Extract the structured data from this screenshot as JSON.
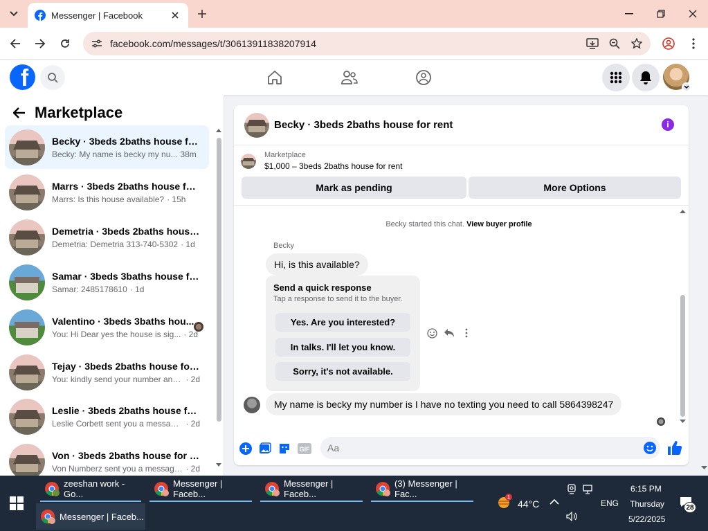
{
  "browser": {
    "tab_title": "Messenger | Facebook",
    "url": "facebook.com/messages/t/30613911838207914"
  },
  "sidebar": {
    "title": "Marketplace",
    "conversations": [
      {
        "name": "Becky · 3beds 2baths house for ...",
        "preview": "Becky: My name is becky my nu...",
        "time": "38m",
        "thumb": "house1",
        "active": true
      },
      {
        "name": "Marrs · 3beds 2baths house for ...",
        "preview": "Marrs: Is this house available?",
        "time": "· 15h",
        "thumb": "house1"
      },
      {
        "name": "Demetria · 3beds 2baths house ...",
        "preview": "Demetria: Demetria 313-740-5302",
        "time": "· 1d",
        "thumb": "house1"
      },
      {
        "name": "Samar · 3beds 3baths house for ...",
        "preview": "Samar: 2485178610",
        "time": "· 1d",
        "thumb": "house2"
      },
      {
        "name": "Valentino · 3beds 3baths hou...",
        "preview": "You: Hi Dear yes the house is sig...",
        "time": "· 2d",
        "thumb": "house2",
        "mini": true
      },
      {
        "name": "Tejay · 3beds 2baths house for r...",
        "preview": "You: kindly send your number and ...",
        "time": "· 2d",
        "thumb": "house1"
      },
      {
        "name": "Leslie · 3beds 2baths house for r...",
        "preview": "Leslie Corbett sent you a message ...",
        "time": "· 2d",
        "thumb": "house1"
      },
      {
        "name": "Von · 3beds 2baths house for rent",
        "preview": "Von Numberz sent you a message ...",
        "time": "· 2d",
        "thumb": "house1"
      }
    ]
  },
  "chat": {
    "title": "Becky · 3beds 2baths house for rent",
    "marketplace_label": "Marketplace",
    "listing": "$1,000 – 3beds 2baths house for rent",
    "mark_pending": "Mark as pending",
    "more_options": "More Options",
    "notice_text": "Becky started this chat.",
    "notice_link": "View buyer profile",
    "sender": "Becky",
    "msg1": "Hi, is this available?",
    "quick_title": "Send a quick response",
    "quick_sub": "Tap a response to send it to the buyer.",
    "quick_responses": [
      "Yes. Are you interested?",
      "In talks. I'll let you know.",
      "Sorry, it's not available."
    ],
    "msg2": "My name is becky my number is I have no texting you need to call 5864398247",
    "input_placeholder": "Aa"
  },
  "taskbar": {
    "apps": [
      {
        "label": "zeeshan work - Go...",
        "badge": "Z"
      },
      {
        "label": "Messenger | Faceb...",
        "badge": ""
      },
      {
        "label": "Messenger | Faceb...",
        "badge": ""
      },
      {
        "label": "(3) Messenger | Fac...",
        "badge": ""
      },
      {
        "label": "Messenger | Faceb...",
        "badge": ""
      }
    ],
    "weather_temp": "44°C",
    "weather_badge": "1",
    "language": "ENG",
    "time": "6:15 PM",
    "day": "Thursday",
    "date": "5/22/2025",
    "notif_count": "28"
  },
  "colors": {
    "accent": "#0866ff",
    "tabbar": "#f9d7ce",
    "active_conv": "#ebf5ff",
    "info": "#8a2be2"
  }
}
